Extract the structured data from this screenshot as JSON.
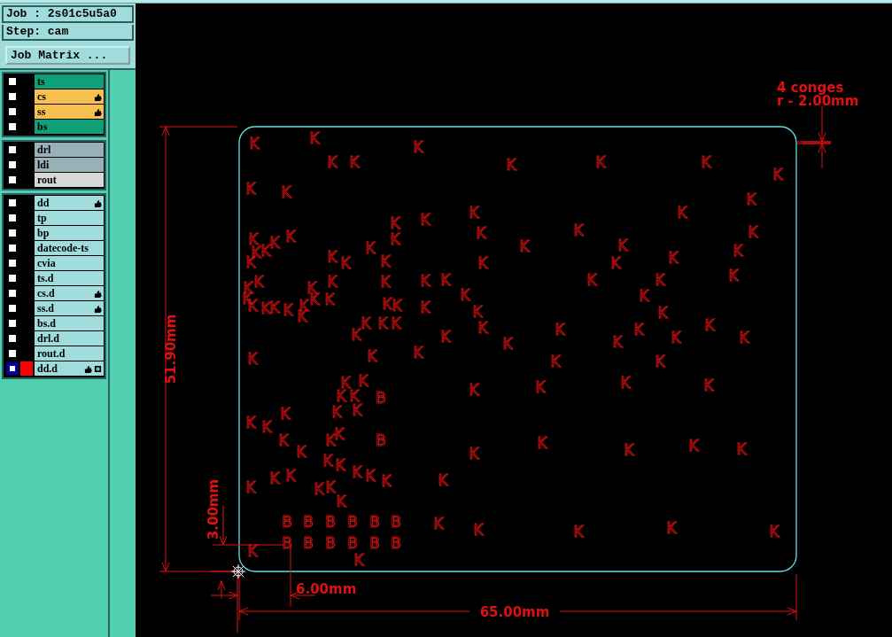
{
  "job_label": "Job : 2s01c5u5a0",
  "step_label": "Step: cam",
  "matrix_button": "Job Matrix ...",
  "layer_groups": [
    {
      "layers": [
        {
          "name": "ts",
          "color": "#10a078",
          "displayed": false,
          "affected": false,
          "selected": false,
          "grid_icon": false
        },
        {
          "name": "cs",
          "color": "#f8c050",
          "displayed": false,
          "affected": true,
          "selected": false,
          "grid_icon": false
        },
        {
          "name": "ss",
          "color": "#f8c050",
          "displayed": false,
          "affected": true,
          "selected": false,
          "grid_icon": false
        },
        {
          "name": "bs",
          "color": "#10a078",
          "displayed": false,
          "affected": false,
          "selected": false,
          "grid_icon": false
        }
      ]
    },
    {
      "layers": [
        {
          "name": "drl",
          "color": "#98b0b8",
          "displayed": false,
          "affected": false,
          "selected": false,
          "grid_icon": false
        },
        {
          "name": "ldi",
          "color": "#98b0b8",
          "displayed": false,
          "affected": false,
          "selected": false,
          "grid_icon": false
        },
        {
          "name": "rout",
          "color": "#d8d8d8",
          "displayed": false,
          "affected": false,
          "selected": false,
          "grid_icon": false
        }
      ]
    },
    {
      "layers": [
        {
          "name": "dd",
          "color": "#a0dcdc",
          "displayed": false,
          "affected": true,
          "selected": false,
          "grid_icon": false
        },
        {
          "name": "tp",
          "color": "#a0dcdc",
          "displayed": false,
          "affected": false,
          "selected": false,
          "grid_icon": false
        },
        {
          "name": "bp",
          "color": "#a0dcdc",
          "displayed": false,
          "affected": false,
          "selected": false,
          "grid_icon": false
        },
        {
          "name": "datecode-ts",
          "color": "#a0dcdc",
          "displayed": false,
          "affected": false,
          "selected": false,
          "grid_icon": false
        },
        {
          "name": "cvia",
          "color": "#a0dcdc",
          "displayed": false,
          "affected": false,
          "selected": false,
          "grid_icon": false
        },
        {
          "name": "ts.d",
          "color": "#a0dcdc",
          "displayed": false,
          "affected": false,
          "selected": false,
          "grid_icon": false
        },
        {
          "name": "cs.d",
          "color": "#a0dcdc",
          "displayed": false,
          "affected": true,
          "selected": false,
          "grid_icon": false
        },
        {
          "name": "ss.d",
          "color": "#a0dcdc",
          "displayed": false,
          "affected": true,
          "selected": false,
          "grid_icon": false
        },
        {
          "name": "bs.d",
          "color": "#a0dcdc",
          "displayed": false,
          "affected": false,
          "selected": false,
          "grid_icon": false
        },
        {
          "name": "drl.d",
          "color": "#a0dcdc",
          "displayed": false,
          "affected": false,
          "selected": false,
          "grid_icon": false
        },
        {
          "name": "rout.d",
          "color": "#a0dcdc",
          "displayed": false,
          "affected": false,
          "selected": false,
          "grid_icon": false
        },
        {
          "name": "dd.d",
          "color": "#a0dcdc",
          "displayed": true,
          "affected": true,
          "selected": true,
          "grid_icon": true
        }
      ]
    }
  ],
  "board": {
    "fillet_note": "4 conges",
    "fillet_radius": "r - 2.00mm",
    "height_dimension": "51.90mm",
    "width_dimension": "65.00mm",
    "offset_y_dimension": "3.00mm",
    "offset_x_dimension": "6.00mm",
    "k_marks": [
      "K",
      "K",
      "K",
      "K",
      "K",
      "K",
      "K",
      "K",
      "K",
      "K",
      "K",
      "K",
      "K",
      "K",
      "K",
      "K",
      "K",
      "K",
      "K",
      "K",
      "K",
      "K",
      "K",
      "K",
      "K",
      "K",
      "K",
      "K",
      "K",
      "K",
      "K",
      "K",
      "K",
      "K",
      "K",
      "K",
      "K",
      "K",
      "K",
      "K",
      "K",
      "K",
      "K",
      "K",
      "K",
      "K",
      "K",
      "K",
      "K",
      "K",
      "K",
      "K",
      "K",
      "K",
      "K",
      "K",
      "K",
      "K",
      "K",
      "K",
      "K",
      "K",
      "K",
      "K",
      "K",
      "K",
      "K",
      "K",
      "K",
      "K",
      "K",
      "K",
      "K",
      "K",
      "K",
      "K",
      "K",
      "K",
      "K",
      "K",
      "K",
      "K",
      "K",
      "K",
      "K",
      "K",
      "K",
      "K",
      "K",
      "K",
      "K",
      "K",
      "K",
      "K",
      "K",
      "K",
      "K",
      "K",
      "K",
      "K",
      "K",
      "K",
      "K",
      "K",
      "K",
      "K",
      "K",
      "K",
      "K",
      "K",
      "K",
      "K",
      "K",
      "K",
      "K",
      "K",
      "K",
      "K",
      "K",
      "K",
      "K"
    ],
    "b_marks": [
      "B",
      "B",
      "B",
      "B",
      "B",
      "B",
      "B",
      "B",
      "B",
      "B",
      "B",
      "B",
      "B",
      "B"
    ]
  }
}
